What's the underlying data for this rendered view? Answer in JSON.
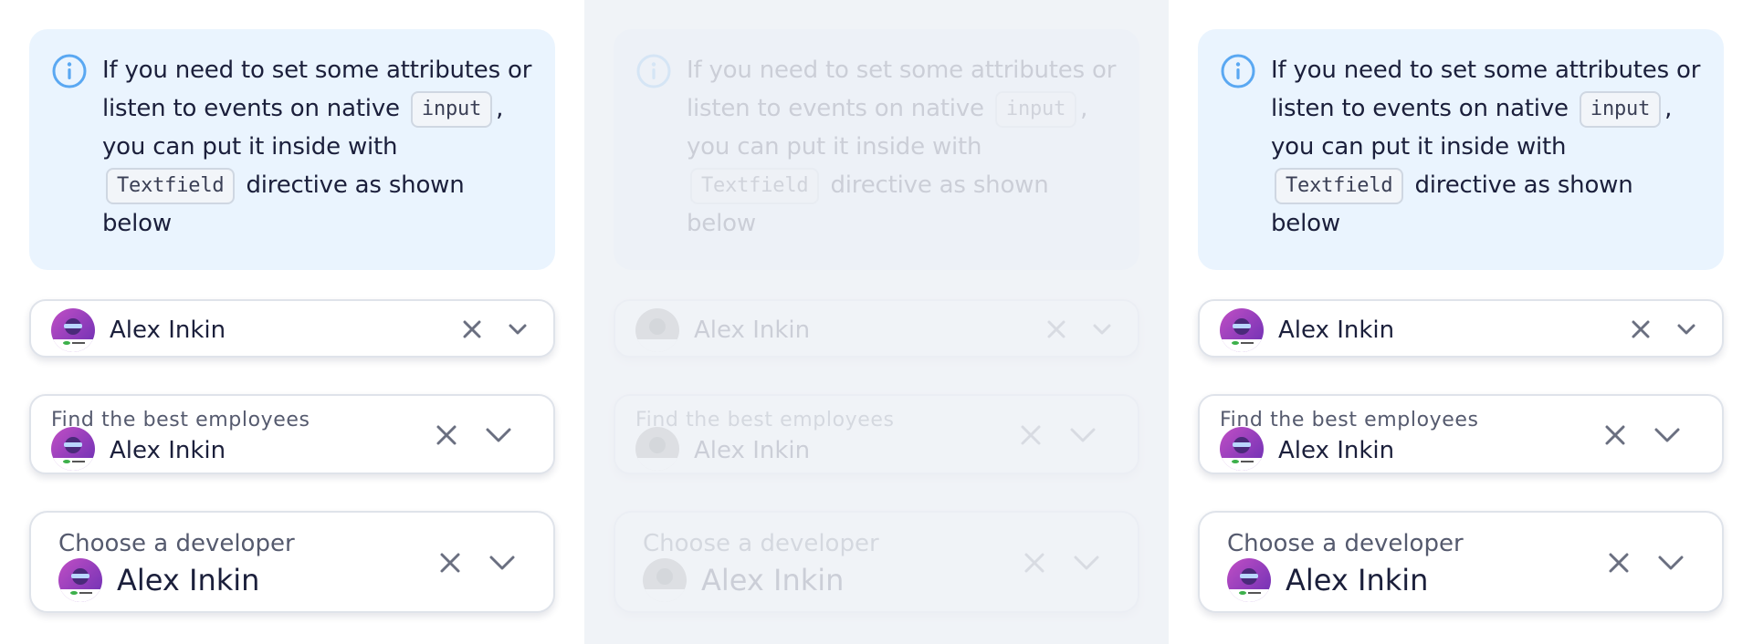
{
  "panels": [
    {
      "state": "normal",
      "notification": {
        "text_1": "If you need to set some attributes or listen to events on native",
        "code_1": "input",
        "text_2": ", you can put it inside with",
        "code_2": "Textfield",
        "text_3": "directive as shown below"
      },
      "small_field": {
        "value": "Alex Inkin"
      },
      "medium_field": {
        "label": "Find the best employees",
        "value": "Alex Inkin"
      },
      "large_field": {
        "label": "Choose a developer",
        "value": "Alex Inkin"
      }
    },
    {
      "state": "disabled",
      "notification": {
        "text_1": "If you need to set some attributes or listen to events on native",
        "code_1": "input",
        "text_2": ", you can put it inside with",
        "code_2": "Textfield",
        "text_3": "directive as shown below"
      },
      "small_field": {
        "value": "Alex Inkin"
      },
      "medium_field": {
        "label": "Find the best employees",
        "value": "Alex Inkin"
      },
      "large_field": {
        "label": "Choose a developer",
        "value": "Alex Inkin"
      }
    },
    {
      "state": "normal",
      "notification": {
        "text_1": "If you need to set some attributes or listen to events on native",
        "code_1": "input",
        "text_2": ", you can put it inside with",
        "code_2": "Textfield",
        "text_3": "directive as shown below"
      },
      "small_field": {
        "value": "Alex Inkin"
      },
      "medium_field": {
        "label": "Find the best employees",
        "value": "Alex Inkin"
      },
      "large_field": {
        "label": "Choose a developer",
        "value": "Alex Inkin"
      }
    }
  ],
  "colors": {
    "notification_bg": "#eaf4fe",
    "info_icon": "#5aa8f2",
    "icon_gray": "#6a6f80",
    "text_primary": "#1b1f3b",
    "text_label": "#555a6e"
  }
}
